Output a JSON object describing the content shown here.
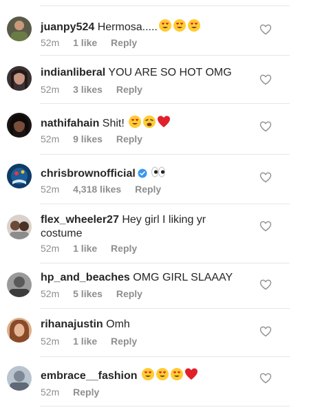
{
  "comments": [
    {
      "username": "juanpy524",
      "text": "Hermosa.....",
      "time": "52m",
      "likes": "1 like",
      "reply": "Reply",
      "emojis": [
        "smiling-face-with-heart-eyes-icon",
        "smiling-face-with-heart-eyes-icon",
        "smiling-face-with-heart-eyes-icon"
      ]
    },
    {
      "username": "indianliberal",
      "text": "YOU ARE SO HOT OMG",
      "time": "52m",
      "likes": "3 likes",
      "reply": "Reply",
      "emojis": []
    },
    {
      "username": "nathifahain",
      "text": "Shit!",
      "time": "52m",
      "likes": "9 likes",
      "reply": "Reply",
      "emojis": [
        "smiling-face-with-heart-eyes-icon",
        "weary-face-icon",
        "red-heart-icon"
      ]
    },
    {
      "username": "chrisbrownofficial",
      "text": "",
      "time": "52m",
      "likes": "4,318 likes",
      "reply": "Reply",
      "verified": true,
      "emojis": [
        "eyes-icon"
      ]
    },
    {
      "username": "flex_wheeler27",
      "text": "Hey girl I liking yr costume",
      "time": "52m",
      "likes": "1 like",
      "reply": "Reply",
      "emojis": []
    },
    {
      "username": "hp_and_beaches",
      "text": "OMG GIRL SLAAAY",
      "time": "52m",
      "likes": "5 likes",
      "reply": "Reply",
      "emojis": []
    },
    {
      "username": "rihanajustin",
      "text": "Omh",
      "time": "52m",
      "likes": "1 like",
      "reply": "Reply",
      "emojis": []
    },
    {
      "username": "embrace__fashion",
      "text": "",
      "time": "52m",
      "likes": "",
      "reply": "Reply",
      "emojis": [
        "smiling-face-with-heart-eyes-icon",
        "smiling-face-with-heart-eyes-icon",
        "smiling-face-with-heart-eyes-icon",
        "red-heart-icon"
      ]
    }
  ],
  "colors": {
    "text": "#262626",
    "meta": "#8e8e8e",
    "verified": "#3897f0",
    "heart": "#e0245e",
    "emoji_face": "#ffcc33"
  }
}
